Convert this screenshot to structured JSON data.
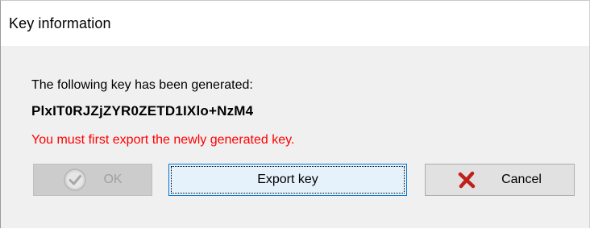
{
  "window": {
    "title": "Key information"
  },
  "message": {
    "intro": "The following key has been generated:",
    "key": "PlxIT0RJZjZYR0ZETD1IXlo+NzM4",
    "warning": "You must first export the newly generated key."
  },
  "buttons": {
    "ok": {
      "label": "OK",
      "icon": "check-circle-icon",
      "enabled": false
    },
    "export": {
      "label": "Export key",
      "focused": true
    },
    "cancel": {
      "label": "Cancel",
      "icon": "x-icon"
    }
  },
  "colors": {
    "warning": "#ff0000",
    "cancel_icon": "#c0201a",
    "focus_border": "#0078d7",
    "dialog_bg": "#f0f0f0"
  }
}
